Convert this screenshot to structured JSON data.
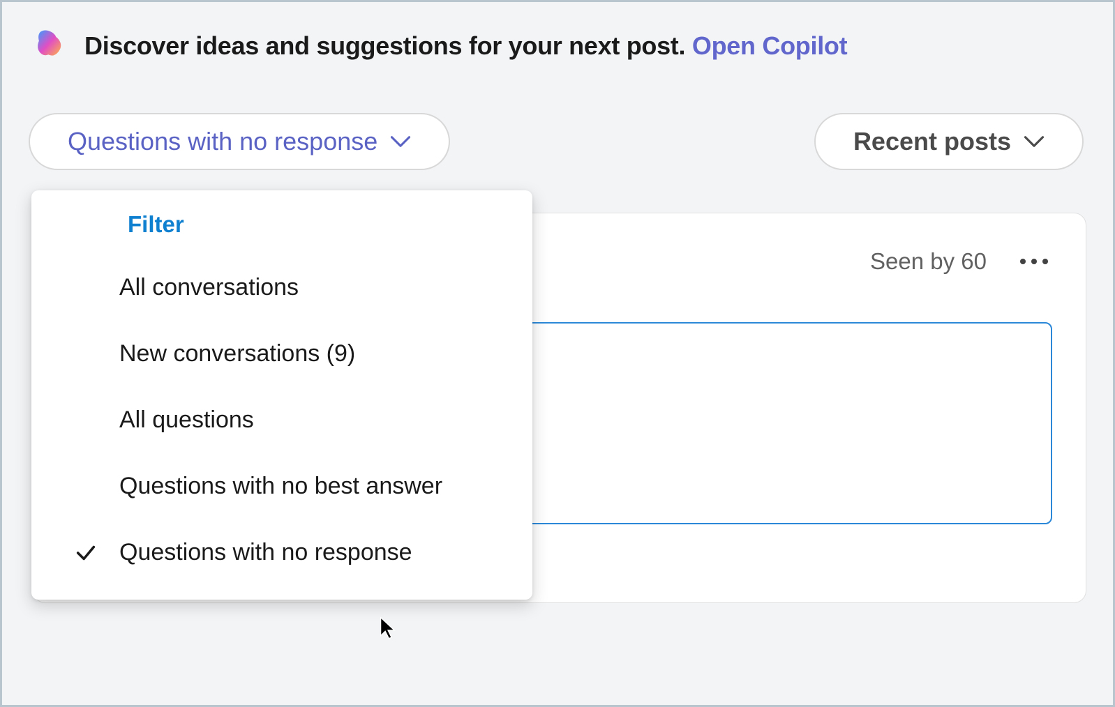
{
  "banner": {
    "text": "Discover ideas and suggestions for your next post.",
    "link_label": "Open Copilot"
  },
  "filter_dropdown": {
    "selected_label": "Questions with no response",
    "menu_header": "Filter",
    "options": [
      {
        "label": "All conversations",
        "selected": false
      },
      {
        "label": "New conversations (9)",
        "selected": false
      },
      {
        "label": "All questions",
        "selected": false
      },
      {
        "label": "Questions with no best answer",
        "selected": false
      },
      {
        "label": "Questions with no response",
        "selected": true
      }
    ]
  },
  "sort_dropdown": {
    "selected_label": "Recent posts"
  },
  "post": {
    "seen_label": "Seen by 60"
  }
}
